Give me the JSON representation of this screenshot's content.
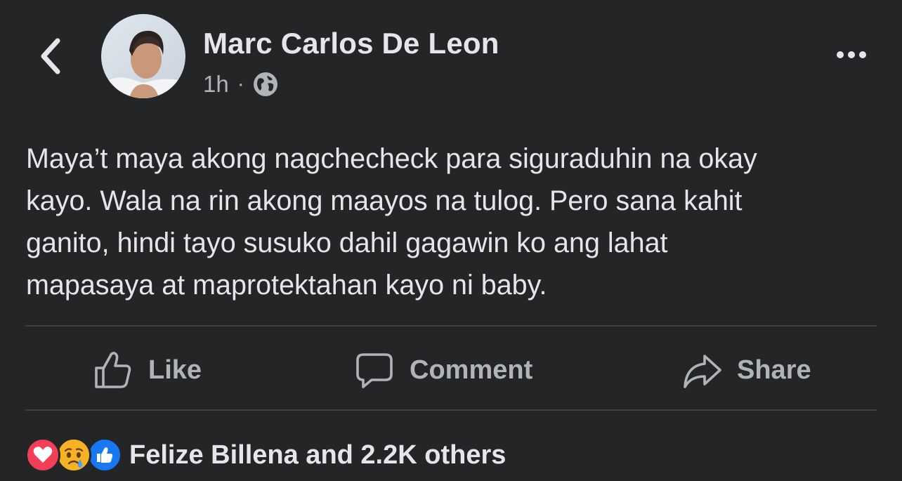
{
  "post": {
    "author": "Marc Carlos De Leon",
    "time": "1h",
    "separator": "·",
    "audience_icon": "globe-icon",
    "lines": [
      "Maya’t maya akong nagchecheck para siguraduhin na okay",
      "kayo. Wala na rin akong maayos na tulog. Pero sana kahit",
      "ganito, hindi tayo susuko dahil gagawin ko ang lahat",
      "mapasaya at maprotektahan kayo ni baby."
    ]
  },
  "actions": {
    "like": "Like",
    "comment": "Comment",
    "share": "Share"
  },
  "reactions": {
    "icons": [
      "love-reaction-icon",
      "sad-reaction-icon",
      "like-reaction-icon"
    ],
    "summary": "Felize Billena and 2.2K others"
  },
  "colors": {
    "background": "#242526",
    "primary_text": "#e4e6eb",
    "secondary_text": "#b0b3b8",
    "divider": "#3e4042",
    "like_blue": "#1877f2",
    "love_red": "#f33e58",
    "sad_yellow": "#f7b125"
  }
}
